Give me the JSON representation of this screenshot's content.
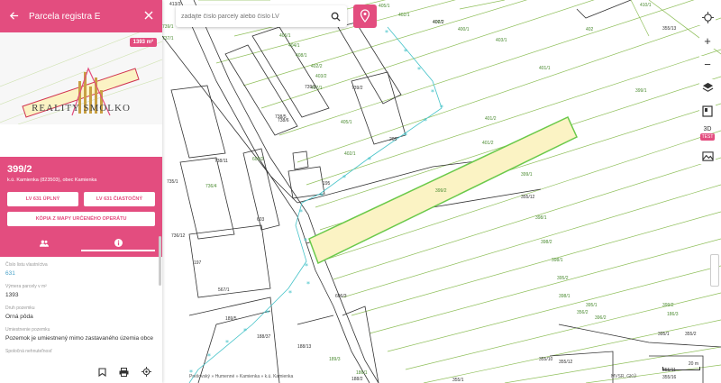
{
  "panel": {
    "title": "Parcela registra E",
    "back_icon": "arrow-left-icon",
    "close_icon": "close-icon",
    "area_badge": "1393 m²",
    "brand": "REALITY SMOLKO",
    "parcel_number": "399/2",
    "location": "k.ú. Kamienka (823503), obec Kamienka",
    "buttons": {
      "lv_full": "LV 631 ÚPLNÝ",
      "lv_partial": "LV 631 ČIASTOČNÝ",
      "copy_map": "KÓPIA Z MAPY URČENÉHO OPERÁTU"
    },
    "tabs": [
      {
        "icon": "owners-icon"
      },
      {
        "icon": "info-icon"
      }
    ],
    "attributes": [
      {
        "label": "Číslo listu vlastníctva",
        "value": "631",
        "link": true
      },
      {
        "label": "Výmera parcely v m²",
        "value": "1393"
      },
      {
        "label": "Druh pozemku",
        "value": "Orná pôda"
      },
      {
        "label": "Umiestnenie pozemku",
        "value": "Pozemok je umiestnený mimo zastavaného územia obce"
      },
      {
        "label": "Spoločná nehnuteľnosť",
        "value": ""
      }
    ],
    "bottom_icons": [
      "bookmark-icon",
      "print-icon",
      "locate-icon"
    ]
  },
  "search": {
    "placeholder": "zadajte číslo parcely alebo číslo LV"
  },
  "toolbar": {
    "three_d": "3D",
    "badge": "TEST"
  },
  "map": {
    "breadcrumb": "Prešovský » Humenné » Kamienka » k.ú. Kamienka",
    "attribution": "MVSR, GKÚ",
    "scale": "20 m",
    "colors": {
      "accent": "#e34d7f",
      "parcel_lines": "#8fbf5a",
      "highlight_fill": "#fbf3c4",
      "highlight_stroke": "#6ac94a",
      "boundary": "#46c3c9"
    },
    "labels": [
      "413/3",
      "405/1",
      "402/1",
      "406/2",
      "400/1",
      "403/1",
      "407/2",
      "402",
      "410/1",
      "355/13",
      "739/1",
      "737/1",
      "405/1",
      "404/1",
      "408/1",
      "402/2",
      "403/2",
      "407/1",
      "739/3",
      "739/2",
      "738/6",
      "405/1",
      "401/2",
      "399/1",
      "738/5",
      "738/11",
      "606/2",
      "401/2",
      "402/1",
      "203",
      "401/1",
      "399/1",
      "395",
      "735/1",
      "736/4",
      "355/12",
      "399/2",
      "398/1",
      "736/12",
      "603",
      "398/2",
      "398/1",
      "395/2",
      "197",
      "398/1",
      "356/2",
      "567/1",
      "606/3",
      "395/1",
      "396/2",
      "399/2",
      "189/5",
      "188/37",
      "188/13",
      "186/3",
      "395/1",
      "355/2",
      "189/3",
      "186/1",
      "355/10",
      "355/12",
      "188/2",
      "355/1",
      "355/11",
      "355/16"
    ]
  }
}
